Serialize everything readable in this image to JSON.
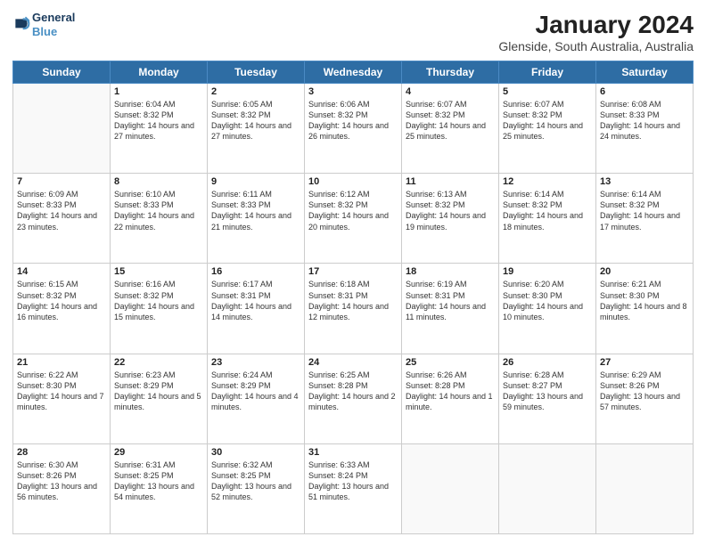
{
  "logo": {
    "line1": "General",
    "line2": "Blue"
  },
  "title": "January 2024",
  "subtitle": "Glenside, South Australia, Australia",
  "days_of_week": [
    "Sunday",
    "Monday",
    "Tuesday",
    "Wednesday",
    "Thursday",
    "Friday",
    "Saturday"
  ],
  "weeks": [
    [
      {
        "day": "",
        "sunrise": "",
        "sunset": "",
        "daylight": ""
      },
      {
        "day": "1",
        "sunrise": "Sunrise: 6:04 AM",
        "sunset": "Sunset: 8:32 PM",
        "daylight": "Daylight: 14 hours and 27 minutes."
      },
      {
        "day": "2",
        "sunrise": "Sunrise: 6:05 AM",
        "sunset": "Sunset: 8:32 PM",
        "daylight": "Daylight: 14 hours and 27 minutes."
      },
      {
        "day": "3",
        "sunrise": "Sunrise: 6:06 AM",
        "sunset": "Sunset: 8:32 PM",
        "daylight": "Daylight: 14 hours and 26 minutes."
      },
      {
        "day": "4",
        "sunrise": "Sunrise: 6:07 AM",
        "sunset": "Sunset: 8:32 PM",
        "daylight": "Daylight: 14 hours and 25 minutes."
      },
      {
        "day": "5",
        "sunrise": "Sunrise: 6:07 AM",
        "sunset": "Sunset: 8:32 PM",
        "daylight": "Daylight: 14 hours and 25 minutes."
      },
      {
        "day": "6",
        "sunrise": "Sunrise: 6:08 AM",
        "sunset": "Sunset: 8:33 PM",
        "daylight": "Daylight: 14 hours and 24 minutes."
      }
    ],
    [
      {
        "day": "7",
        "sunrise": "Sunrise: 6:09 AM",
        "sunset": "Sunset: 8:33 PM",
        "daylight": "Daylight: 14 hours and 23 minutes."
      },
      {
        "day": "8",
        "sunrise": "Sunrise: 6:10 AM",
        "sunset": "Sunset: 8:33 PM",
        "daylight": "Daylight: 14 hours and 22 minutes."
      },
      {
        "day": "9",
        "sunrise": "Sunrise: 6:11 AM",
        "sunset": "Sunset: 8:33 PM",
        "daylight": "Daylight: 14 hours and 21 minutes."
      },
      {
        "day": "10",
        "sunrise": "Sunrise: 6:12 AM",
        "sunset": "Sunset: 8:32 PM",
        "daylight": "Daylight: 14 hours and 20 minutes."
      },
      {
        "day": "11",
        "sunrise": "Sunrise: 6:13 AM",
        "sunset": "Sunset: 8:32 PM",
        "daylight": "Daylight: 14 hours and 19 minutes."
      },
      {
        "day": "12",
        "sunrise": "Sunrise: 6:14 AM",
        "sunset": "Sunset: 8:32 PM",
        "daylight": "Daylight: 14 hours and 18 minutes."
      },
      {
        "day": "13",
        "sunrise": "Sunrise: 6:14 AM",
        "sunset": "Sunset: 8:32 PM",
        "daylight": "Daylight: 14 hours and 17 minutes."
      }
    ],
    [
      {
        "day": "14",
        "sunrise": "Sunrise: 6:15 AM",
        "sunset": "Sunset: 8:32 PM",
        "daylight": "Daylight: 14 hours and 16 minutes."
      },
      {
        "day": "15",
        "sunrise": "Sunrise: 6:16 AM",
        "sunset": "Sunset: 8:32 PM",
        "daylight": "Daylight: 14 hours and 15 minutes."
      },
      {
        "day": "16",
        "sunrise": "Sunrise: 6:17 AM",
        "sunset": "Sunset: 8:31 PM",
        "daylight": "Daylight: 14 hours and 14 minutes."
      },
      {
        "day": "17",
        "sunrise": "Sunrise: 6:18 AM",
        "sunset": "Sunset: 8:31 PM",
        "daylight": "Daylight: 14 hours and 12 minutes."
      },
      {
        "day": "18",
        "sunrise": "Sunrise: 6:19 AM",
        "sunset": "Sunset: 8:31 PM",
        "daylight": "Daylight: 14 hours and 11 minutes."
      },
      {
        "day": "19",
        "sunrise": "Sunrise: 6:20 AM",
        "sunset": "Sunset: 8:30 PM",
        "daylight": "Daylight: 14 hours and 10 minutes."
      },
      {
        "day": "20",
        "sunrise": "Sunrise: 6:21 AM",
        "sunset": "Sunset: 8:30 PM",
        "daylight": "Daylight: 14 hours and 8 minutes."
      }
    ],
    [
      {
        "day": "21",
        "sunrise": "Sunrise: 6:22 AM",
        "sunset": "Sunset: 8:30 PM",
        "daylight": "Daylight: 14 hours and 7 minutes."
      },
      {
        "day": "22",
        "sunrise": "Sunrise: 6:23 AM",
        "sunset": "Sunset: 8:29 PM",
        "daylight": "Daylight: 14 hours and 5 minutes."
      },
      {
        "day": "23",
        "sunrise": "Sunrise: 6:24 AM",
        "sunset": "Sunset: 8:29 PM",
        "daylight": "Daylight: 14 hours and 4 minutes."
      },
      {
        "day": "24",
        "sunrise": "Sunrise: 6:25 AM",
        "sunset": "Sunset: 8:28 PM",
        "daylight": "Daylight: 14 hours and 2 minutes."
      },
      {
        "day": "25",
        "sunrise": "Sunrise: 6:26 AM",
        "sunset": "Sunset: 8:28 PM",
        "daylight": "Daylight: 14 hours and 1 minute."
      },
      {
        "day": "26",
        "sunrise": "Sunrise: 6:28 AM",
        "sunset": "Sunset: 8:27 PM",
        "daylight": "Daylight: 13 hours and 59 minutes."
      },
      {
        "day": "27",
        "sunrise": "Sunrise: 6:29 AM",
        "sunset": "Sunset: 8:26 PM",
        "daylight": "Daylight: 13 hours and 57 minutes."
      }
    ],
    [
      {
        "day": "28",
        "sunrise": "Sunrise: 6:30 AM",
        "sunset": "Sunset: 8:26 PM",
        "daylight": "Daylight: 13 hours and 56 minutes."
      },
      {
        "day": "29",
        "sunrise": "Sunrise: 6:31 AM",
        "sunset": "Sunset: 8:25 PM",
        "daylight": "Daylight: 13 hours and 54 minutes."
      },
      {
        "day": "30",
        "sunrise": "Sunrise: 6:32 AM",
        "sunset": "Sunset: 8:25 PM",
        "daylight": "Daylight: 13 hours and 52 minutes."
      },
      {
        "day": "31",
        "sunrise": "Sunrise: 6:33 AM",
        "sunset": "Sunset: 8:24 PM",
        "daylight": "Daylight: 13 hours and 51 minutes."
      },
      {
        "day": "",
        "sunrise": "",
        "sunset": "",
        "daylight": ""
      },
      {
        "day": "",
        "sunrise": "",
        "sunset": "",
        "daylight": ""
      },
      {
        "day": "",
        "sunrise": "",
        "sunset": "",
        "daylight": ""
      }
    ]
  ]
}
